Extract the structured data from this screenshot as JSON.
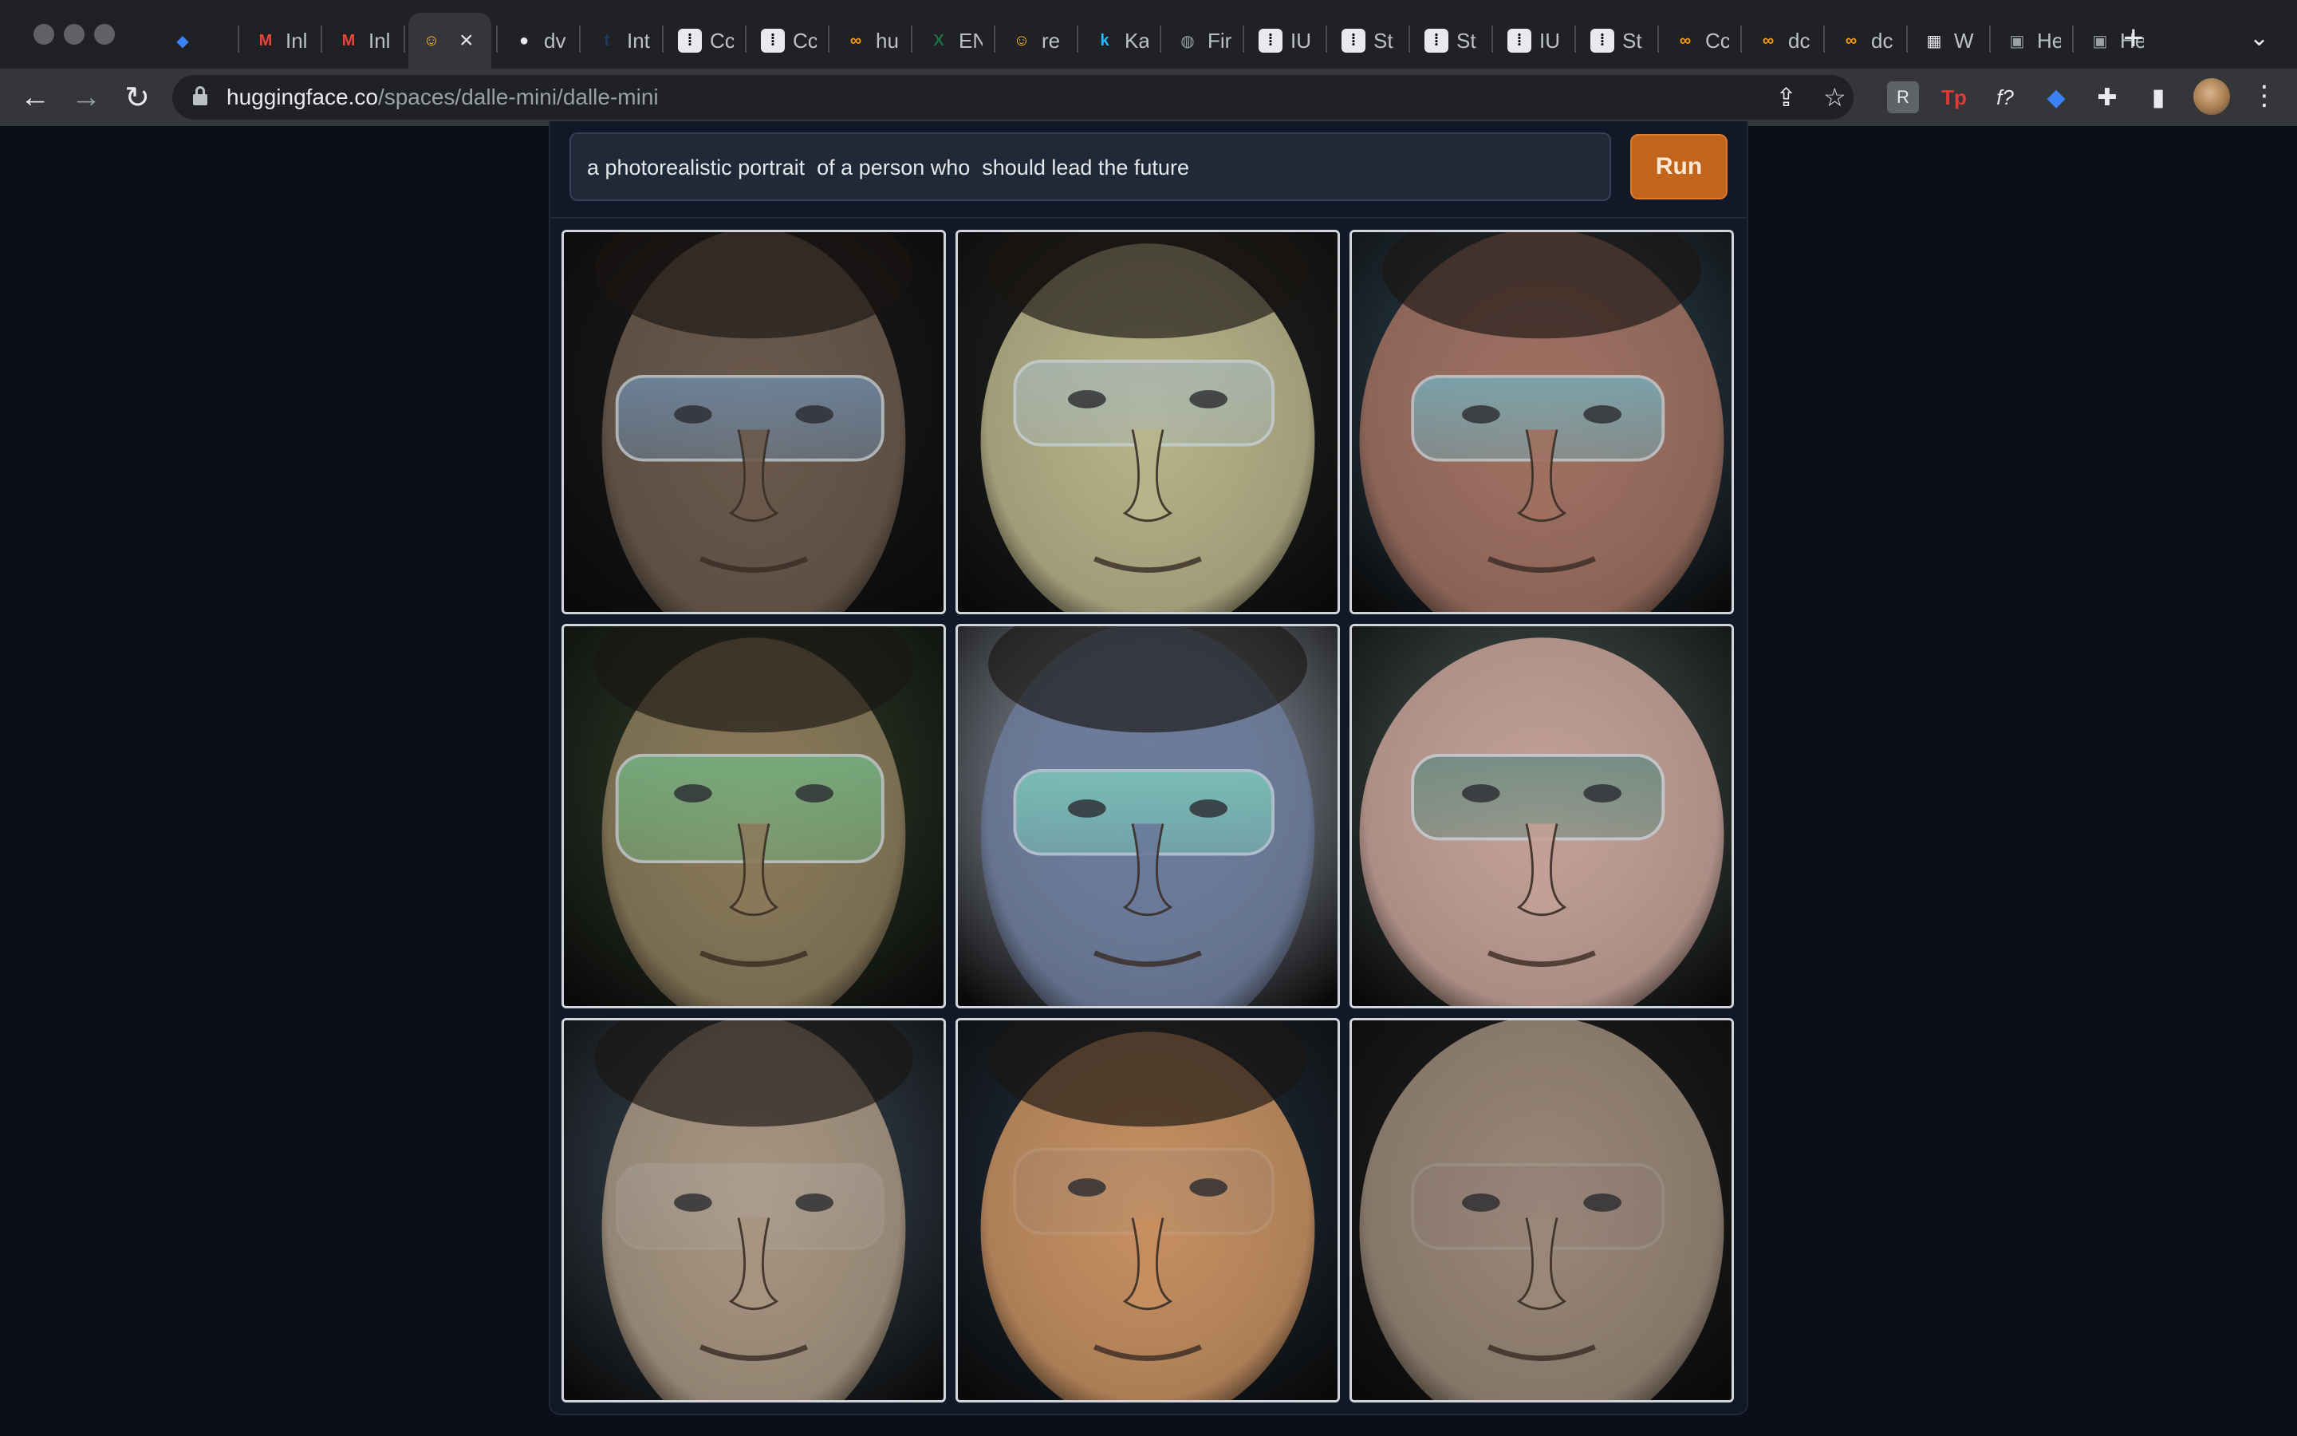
{
  "window": {
    "traffic_lights": [
      "close",
      "minimize",
      "zoom"
    ]
  },
  "tabs": [
    {
      "title": "",
      "icon": "gem-icon",
      "color": "#3b82f6"
    },
    {
      "title": "Inl",
      "icon": "gmail-icon",
      "color": "#ea4335"
    },
    {
      "title": "Inl",
      "icon": "gmail-icon",
      "color": "#ea4335"
    },
    {
      "title": "",
      "icon": "hugging-face-icon",
      "color": "#fbbf24",
      "active": true
    },
    {
      "title": "dv",
      "icon": "github-icon",
      "color": "#e8eaed"
    },
    {
      "title": "Int",
      "icon": "tds-icon",
      "color": "#1f3a63"
    },
    {
      "title": "Cc",
      "icon": "dots-icon",
      "color": "#000000"
    },
    {
      "title": "Cc",
      "icon": "dots-icon",
      "color": "#000000"
    },
    {
      "title": "hu",
      "icon": "infinity-icon",
      "color": "#f59e0b"
    },
    {
      "title": "EN",
      "icon": "excel-icon",
      "color": "#1d6f42"
    },
    {
      "title": "re",
      "icon": "hugging-face-icon",
      "color": "#fbbf24"
    },
    {
      "title": "Ka",
      "icon": "kaggle-icon",
      "color": "#20beff"
    },
    {
      "title": "Fir",
      "icon": "globe-icon",
      "color": "#9aa0a6"
    },
    {
      "title": "IU",
      "icon": "dots-icon",
      "color": "#000000"
    },
    {
      "title": "St",
      "icon": "dots-icon",
      "color": "#000000"
    },
    {
      "title": "St",
      "icon": "dots-icon",
      "color": "#000000"
    },
    {
      "title": "IU",
      "icon": "dots-icon",
      "color": "#000000"
    },
    {
      "title": "St",
      "icon": "dots-icon",
      "color": "#000000"
    },
    {
      "title": "Cc",
      "icon": "infinity-icon",
      "color": "#f59e0b"
    },
    {
      "title": "dc",
      "icon": "infinity-icon",
      "color": "#f59e0b"
    },
    {
      "title": "dc",
      "icon": "infinity-icon",
      "color": "#f59e0b"
    },
    {
      "title": "W",
      "icon": "qr-icon",
      "color": "#e8eaed"
    },
    {
      "title": "He",
      "icon": "image-icon",
      "color": "#9aa0a6"
    },
    {
      "title": "He",
      "icon": "image-icon",
      "color": "#9aa0a6"
    }
  ],
  "address_bar": {
    "host": "huggingface.co",
    "path": "/spaces/dalle-mini/dalle-mini"
  },
  "extensions": [
    {
      "name": "readwise-extension",
      "glyph": "R",
      "color": "#9aa0a6"
    },
    {
      "name": "tp-extension",
      "glyph": "Tp",
      "color": "#e53935"
    },
    {
      "name": "formula-extension",
      "glyph": "f?",
      "color": "#e8eaed"
    },
    {
      "name": "gem-extension",
      "glyph": "◆",
      "color": "#3b82f6"
    },
    {
      "name": "puzzle-extension",
      "glyph": "✚",
      "color": "#e8eaed"
    },
    {
      "name": "sidepanel-extension",
      "glyph": "▮",
      "color": "#e8eaed"
    }
  ],
  "app": {
    "prompt": "a photorealistic portrait  of a person who  should lead the future",
    "run_label": "Run",
    "accent_color": "#c2651c",
    "generated_images": [
      {
        "label": "portrait-1",
        "skin": "#6b5a4c",
        "bg": "#1e1c1a",
        "lens": "#6f93b8"
      },
      {
        "label": "portrait-2",
        "skin": "#b9b48a",
        "bg": "#2a2a22",
        "lens": "#a8b8ba"
      },
      {
        "label": "portrait-3",
        "skin": "#a07060",
        "bg": "#3c5a6a",
        "lens": "#6fb8c8"
      },
      {
        "label": "portrait-4",
        "skin": "#8a7a5a",
        "bg": "#3a4a2a",
        "lens": "#6fbf8a"
      },
      {
        "label": "portrait-5",
        "skin": "#6a7a9a",
        "bg": "#cfd7e4",
        "lens": "#7fd8c0"
      },
      {
        "label": "portrait-6",
        "skin": "#c4a096",
        "bg": "#5a6a60",
        "lens": "#5a8a80"
      },
      {
        "label": "portrait-7",
        "skin": "#a89580",
        "bg": "#4a5a66",
        "lens": "#c8d8e8"
      },
      {
        "label": "portrait-8",
        "skin": "#c89060",
        "bg": "#2a3a4a",
        "lens": "#7a8aa8"
      },
      {
        "label": "portrait-9",
        "skin": "#9a8878",
        "bg": "#2a2622",
        "lens": "#8a7080"
      }
    ]
  }
}
